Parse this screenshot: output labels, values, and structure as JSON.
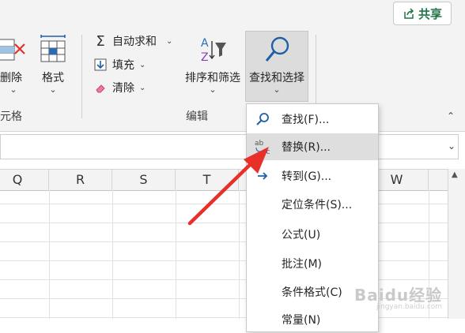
{
  "share": {
    "label": "共享"
  },
  "ribbon": {
    "delete_label": "删除",
    "format_label": "格式",
    "cells_group_label": "单元格",
    "autosum_label": "自动求和",
    "fill_label": "填充",
    "clear_label": "清除",
    "sort_filter_label": "排序和筛选",
    "find_select_label": "查找和选择",
    "editing_group_label": "编辑"
  },
  "columns": [
    "Q",
    "R",
    "S",
    "T",
    "W"
  ],
  "menu": {
    "items": [
      {
        "label": "查找(F)..."
      },
      {
        "label": "替换(R)..."
      },
      {
        "label": "转到(G)..."
      },
      {
        "label": "定位条件(S)..."
      },
      {
        "label": "公式(U)"
      },
      {
        "label": "批注(M)"
      },
      {
        "label": "条件格式(C)"
      },
      {
        "label": "常量(N)"
      }
    ]
  },
  "watermark": {
    "main": "Baidu经验",
    "sub": "jingyan.baidu.com"
  },
  "colors": {
    "accent_red": "#e8302a",
    "excel_green": "#217346",
    "search_blue": "#1f5fa8"
  }
}
